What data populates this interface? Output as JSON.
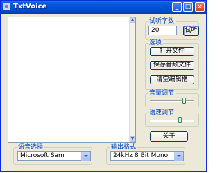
{
  "window": {
    "title": "TxtVoice"
  },
  "trial": {
    "label": "试听字数",
    "value": "20",
    "button": "试听"
  },
  "options": {
    "label": "选项",
    "open_file": "打开文件",
    "save_audio": "保存音频文件",
    "clear_edit": "清空编辑框"
  },
  "volume": {
    "label": "音量调节",
    "level": 0.8
  },
  "speed": {
    "label": "语速调节",
    "level": 0.7
  },
  "about": "关于",
  "voice": {
    "label": "语音选择",
    "selected": "Microsoft Sam"
  },
  "output": {
    "label": "输出格式",
    "selected": "24kHz 8 Bit Mono"
  },
  "colors": {
    "title_bar": "#0052d6",
    "accent_label": "#0046d5",
    "window_bg": "#ece9d8"
  }
}
